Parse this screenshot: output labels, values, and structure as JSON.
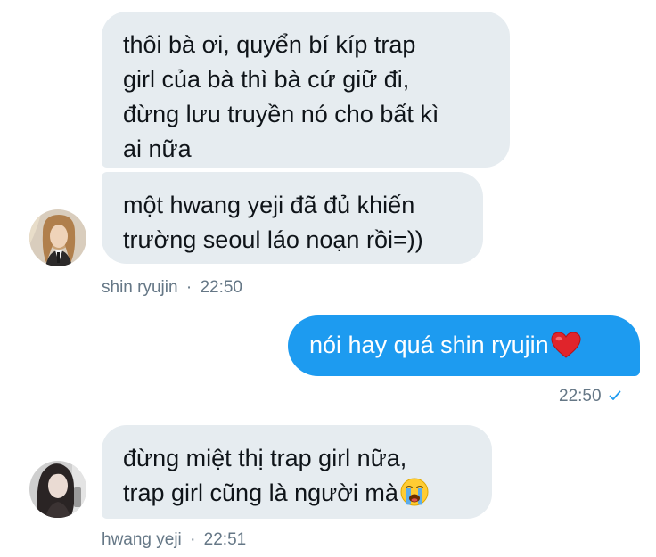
{
  "messages": [
    {
      "side": "incoming",
      "lines": [
        "thôi bà ơi, quyển bí kíp trap",
        "girl của bà thì bà cứ giữ đi,",
        "đừng lưu truyền nó cho bất kì",
        "ai nữa"
      ]
    },
    {
      "side": "incoming",
      "lines": [
        "một hwang yeji đã đủ khiến",
        "trường seoul láo noạn rồi=))"
      ],
      "meta": {
        "sender": "shin ryujin",
        "separator": "·",
        "time": "22:50"
      }
    },
    {
      "side": "outgoing",
      "lines": [
        "nói hay quá shin ryujin"
      ],
      "emoji": "red-heart",
      "meta": {
        "time": "22:50",
        "status_icon": "read-check-icon"
      }
    },
    {
      "side": "incoming",
      "lines": [
        "đừng miệt thị trap girl nữa,",
        "trap girl cũng là người mà"
      ],
      "emoji": "loudly-crying-face",
      "meta": {
        "sender": "hwang yeji",
        "separator": "·",
        "time": "22:51"
      }
    }
  ],
  "colors": {
    "incoming_bubble": "#e6ecf0",
    "outgoing_bubble": "#1d9bf0",
    "meta_text": "#657786",
    "incoming_text": "#0f1419",
    "outgoing_text": "#ffffff"
  }
}
